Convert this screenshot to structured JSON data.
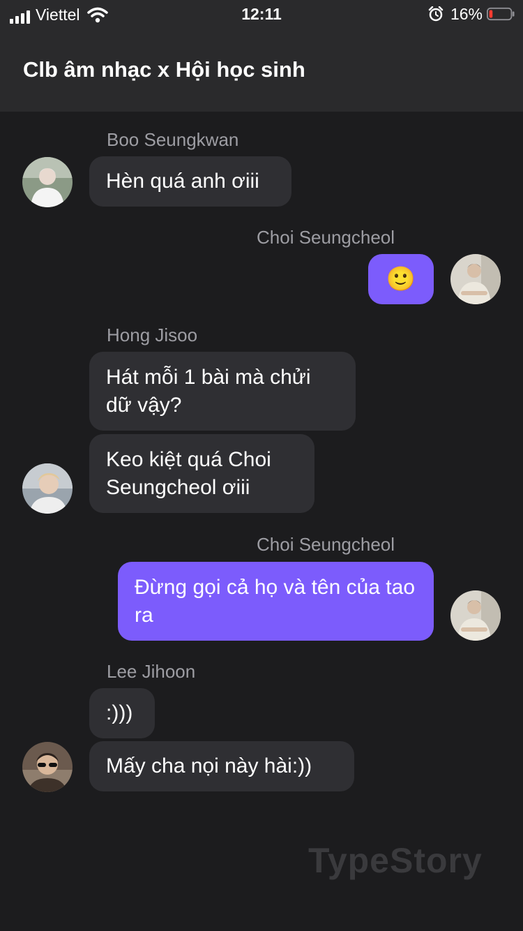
{
  "status_bar": {
    "carrier": "Viettel",
    "time": "12:11",
    "battery_pct": "16%",
    "battery_level": 0.16,
    "icons": [
      "signal-icon",
      "wifi-icon",
      "alarm-icon",
      "battery-icon"
    ]
  },
  "header": {
    "title": "Clb âm nhạc x Hội học sinh"
  },
  "messages": [
    {
      "sender": "Boo Seungkwan",
      "text": "Hèn quá anh ơiii",
      "direction": "incoming"
    },
    {
      "sender": "Choi Seungcheol",
      "text": "🙂",
      "direction": "outgoing"
    },
    {
      "sender": "Hong Jisoo",
      "text": "Hát mỗi 1 bài mà chửi dữ vậy?",
      "direction": "incoming"
    },
    {
      "text": "Keo kiệt quá Choi Seungcheol ơiii",
      "direction": "incoming"
    },
    {
      "sender": "Choi Seungcheol",
      "text": "Đừng gọi cả họ và tên của tao ra",
      "direction": "outgoing"
    },
    {
      "sender": "Lee Jihoon",
      "text": ":)))",
      "direction": "incoming"
    },
    {
      "text": "Mấy cha nọi này hài:))",
      "direction": "incoming"
    }
  ],
  "watermark": "TypeStory",
  "colors": {
    "background": "#1c1c1e",
    "header": "#2a2a2c",
    "incoming_bubble": "#2f2f33",
    "outgoing_bubble": "#7c5cfc",
    "sender_name": "#9d9da3",
    "battery_low": "#ff3b30"
  }
}
